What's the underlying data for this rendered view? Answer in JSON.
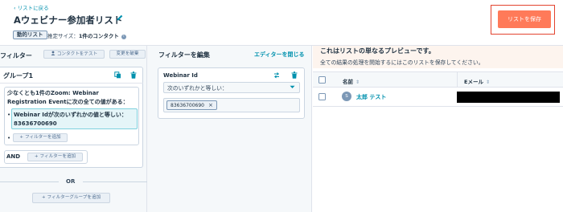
{
  "header": {
    "back_link": "‹ リストに戻る",
    "title": "Aウェビナー参加者リスト",
    "list_type_badge": "動的リスト",
    "estimated_size_label": "推定サイズ：",
    "estimated_size_value": "1件のコンタクト",
    "save_button": "リストを保存"
  },
  "filters_panel": {
    "heading": "フィルター",
    "test_contact_button": "コンタクトをテスト",
    "discard_button": "変更を破棄",
    "group": {
      "title": "グループ1",
      "condition_intro": "少なくとも1件のZoom: Webinar Registration Eventに次の全ての値がある：",
      "condition_detail": "Webinar Idが次のいずれかの値と等しい：83636700690",
      "add_filter_inner": "フィルターを追加"
    },
    "and_label": "AND",
    "add_filter_and": "フィルターを追加",
    "or_label": "OR",
    "add_filter_group": "フィルターグループを追加"
  },
  "edit_panel": {
    "heading": "フィルターを編集",
    "close_editor": "エディターを閉じる",
    "property_name": "Webinar Id",
    "operator_value": "次のいずれかと等しい：",
    "chip_value": "83636700690",
    "chip_remove": "×"
  },
  "preview": {
    "title": "これはリストの単なるプレビューです。",
    "subtitle": "全ての結果の処理を開始するにはこのリストを保存してください。",
    "columns": [
      "名前",
      "Eメール"
    ],
    "sort_glyph": "⇕",
    "rows": [
      {
        "avatar_initial": "S",
        "name": "太郎 テスト",
        "email": ""
      }
    ]
  },
  "colors": {
    "accent_orange": "#ff7a59",
    "link_teal": "#0091ae",
    "highlight_outline": "#e3442f",
    "preview_banner": "#fdf4ee"
  },
  "icons": [
    "pencil-icon",
    "info-icon",
    "copy-icon",
    "trash-icon",
    "swap-icon",
    "chevron-down-icon",
    "plus-icon",
    "close-icon",
    "sort-icon"
  ]
}
